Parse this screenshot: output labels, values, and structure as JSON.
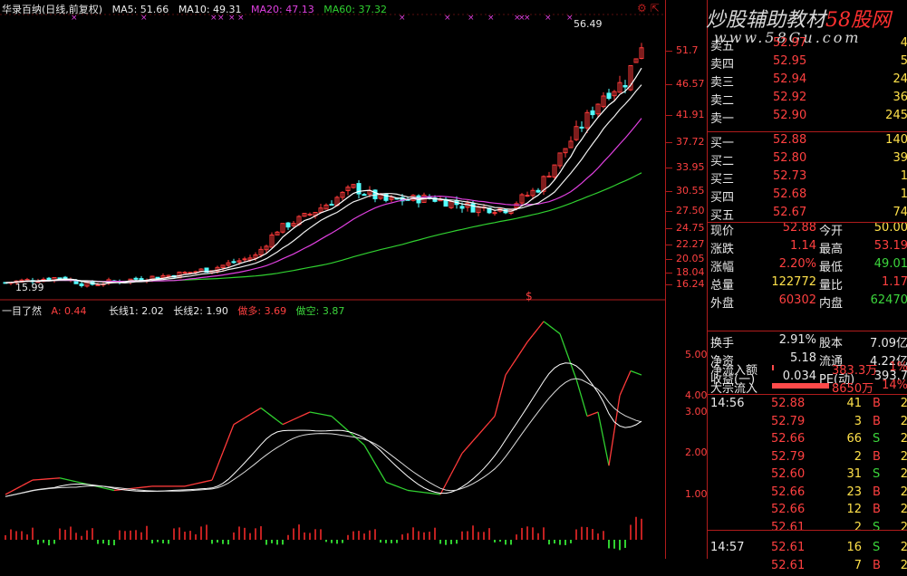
{
  "top_header": {
    "title": "华录百纳(日线,前复权)",
    "ma5": "MA5: 51.66",
    "ma10": "MA10: 49.31",
    "ma20": "MA20: 47.13",
    "ma60": "MA60: 37.32"
  },
  "price_axis": [
    "51.7",
    "46.57",
    "41.91",
    "37.72",
    "33.95",
    "30.55",
    "27.50",
    "24.75",
    "22.27",
    "20.05",
    "18.04",
    "16.24"
  ],
  "high_label": "56.49",
  "low_label": "15.99",
  "indicator_header": {
    "name": "一目了然",
    "a": "A: 0.44",
    "long1": "长线1: 2.02",
    "long2": "长线2: 1.90",
    "long_side": "做多: 3.69",
    "short_side": "做空: 3.87"
  },
  "indicator_axis": [
    "5.00",
    "4.00",
    "3.00",
    "2.00",
    "1.00"
  ],
  "watermark": {
    "text_cn": "炒股辅助教材",
    "text_58": "58股网",
    "url": "www.58Gu.com"
  },
  "order_book": {
    "asks": [
      {
        "label": "卖五",
        "price": "52.97",
        "vol": "4"
      },
      {
        "label": "卖四",
        "price": "52.95",
        "vol": "5"
      },
      {
        "label": "卖三",
        "price": "52.94",
        "vol": "24"
      },
      {
        "label": "卖二",
        "price": "52.92",
        "vol": "36"
      },
      {
        "label": "卖一",
        "price": "52.90",
        "vol": "245"
      }
    ],
    "bids": [
      {
        "label": "买一",
        "price": "52.88",
        "vol": "140"
      },
      {
        "label": "买二",
        "price": "52.80",
        "vol": "39"
      },
      {
        "label": "买三",
        "price": "52.73",
        "vol": "1"
      },
      {
        "label": "买四",
        "price": "52.68",
        "vol": "1"
      },
      {
        "label": "买五",
        "price": "52.67",
        "vol": "74"
      }
    ]
  },
  "quote": [
    {
      "l1": "现价",
      "v1": "52.88",
      "l2": "今开",
      "v2": "50.00"
    },
    {
      "l1": "涨跌",
      "v1": "1.14",
      "l2": "最高",
      "v2": "53.19"
    },
    {
      "l1": "涨幅",
      "v1": "2.20%",
      "l2": "最低",
      "v2": "49.01"
    },
    {
      "l1": "总量",
      "v1": "122772",
      "l2": "量比",
      "v2": "1.17"
    },
    {
      "l1": "外盘",
      "v1": "60302",
      "l2": "内盘",
      "v2": "62470"
    }
  ],
  "stats": [
    {
      "l1": "换手",
      "v1": "2.91%",
      "l2": "股本",
      "v2": "7.09亿"
    },
    {
      "l1": "净资",
      "v1": "5.18",
      "l2": "流通",
      "v2": "4.22亿"
    },
    {
      "l1": "收益(一)",
      "v1": "0.034",
      "l2": "PE(动)",
      "v2": "393.7"
    }
  ],
  "flows": [
    {
      "label": "净流入额",
      "value": "383.3万",
      "pct": "1%",
      "bar": 0.02
    },
    {
      "label": "大宗流入",
      "value": "8650万",
      "pct": "14%",
      "bar": 0.6
    }
  ],
  "ticks": [
    {
      "time": "14:56",
      "price": "52.88",
      "vol": "41",
      "side": "B"
    },
    {
      "time": "",
      "price": "52.79",
      "vol": "3",
      "side": "B"
    },
    {
      "time": "",
      "price": "52.66",
      "vol": "66",
      "side": "S"
    },
    {
      "time": "",
      "price": "52.79",
      "vol": "2",
      "side": "B"
    },
    {
      "time": "",
      "price": "52.60",
      "vol": "31",
      "side": "S"
    },
    {
      "time": "",
      "price": "52.66",
      "vol": "23",
      "side": "B"
    },
    {
      "time": "",
      "price": "52.66",
      "vol": "12",
      "side": "B"
    },
    {
      "time": "",
      "price": "52.61",
      "vol": "2",
      "side": "S"
    },
    {
      "time": "14:57",
      "price": "52.61",
      "vol": "16",
      "side": "S"
    },
    {
      "time": "",
      "price": "52.61",
      "vol": "7",
      "side": "B"
    }
  ],
  "tick_trail": [
    "2",
    "2",
    "2",
    "2",
    "2",
    "2",
    "2",
    "2",
    "2",
    "2"
  ],
  "colors": {
    "up": "#ff3a3a",
    "down": "#54ffff",
    "ma5": "#ffffff",
    "ma10": "#ffff00",
    "ma20": "#e040e0",
    "ma60": "#30d030",
    "grid": "#b01c1c"
  }
}
